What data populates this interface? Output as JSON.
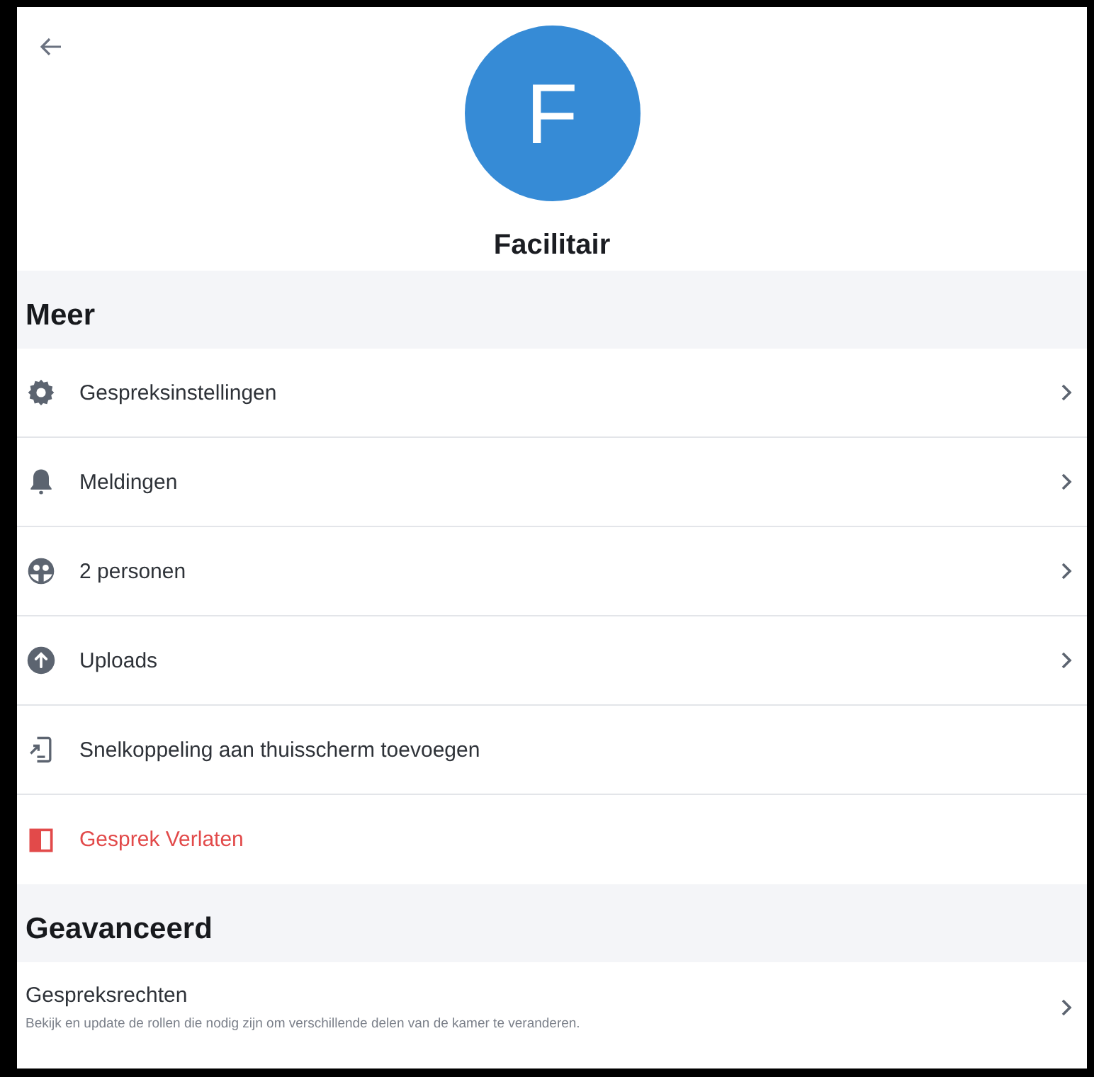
{
  "header": {
    "avatar_letter": "F",
    "title": "Facilitair"
  },
  "sections": [
    {
      "title": "Meer",
      "items": [
        {
          "kind": "link",
          "label": "Gespreksinstellingen"
        },
        {
          "kind": "link",
          "label": "Meldingen"
        },
        {
          "kind": "link",
          "label": "2 personen"
        },
        {
          "kind": "link",
          "label": "Uploads"
        },
        {
          "kind": "action",
          "label": "Snelkoppeling aan thuisscherm toevoegen"
        },
        {
          "kind": "danger",
          "label": "Gesprek Verlaten"
        }
      ]
    },
    {
      "title": "Geavanceerd",
      "items": [
        {
          "kind": "detail",
          "label": "Gespreksrechten",
          "description": "Bekijk en update de rollen die nodig zijn om verschillende delen van de kamer te veranderen."
        }
      ]
    }
  ]
}
